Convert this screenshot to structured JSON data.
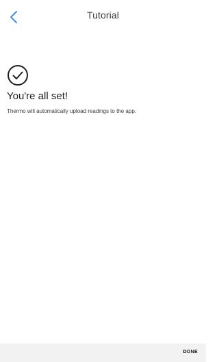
{
  "header": {
    "title": "Tutorial",
    "back_icon": "chevron-left-icon",
    "accent_color": "#3b8ee0"
  },
  "main": {
    "status_icon": "check-circle-icon",
    "headline": "You're all set!",
    "description": "Thermo will automatically upload readings to the app."
  },
  "footer": {
    "done_label": "DONE"
  }
}
